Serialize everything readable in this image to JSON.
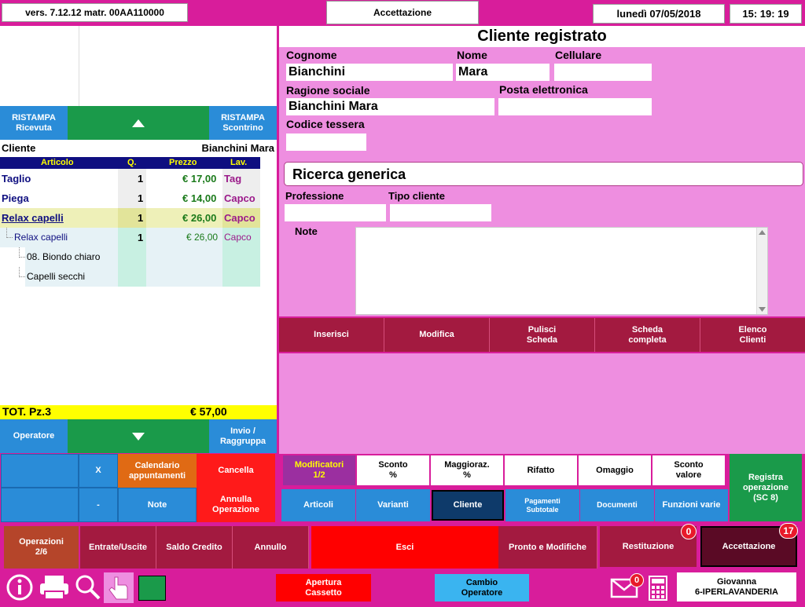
{
  "topbar": {
    "version": "vers. 7.12.12 matr. 00AA110000",
    "title": "Accettazione",
    "date": "lunedì 07/05/2018",
    "time": "15: 19: 19"
  },
  "left": {
    "reprint_receipt": "RISTAMPA\nRicevuta",
    "reprint_ticket": "RISTAMPA\nScontrino",
    "customer_label": "Cliente",
    "customer_name": "Bianchini Mara",
    "columns": [
      "Articolo",
      "Q.",
      "Prezzo",
      "Lav."
    ],
    "rows": [
      {
        "article": "Taglio",
        "qty": "1",
        "price": "€ 17,00",
        "lav": "Tag"
      },
      {
        "article": "Piega",
        "qty": "1",
        "price": "€ 14,00",
        "lav": "Capco"
      },
      {
        "article": "Relax capelli",
        "qty": "1",
        "price": "€ 26,00",
        "lav": "Capco"
      },
      {
        "article": "Relax capelli",
        "qty": "1",
        "price": "€ 26,00",
        "lav": "Capco"
      },
      {
        "article": "08. Biondo chiaro"
      },
      {
        "article": "Capelli secchi"
      }
    ],
    "total_label": "TOT. Pz.3",
    "total_value": "€ 57,00",
    "operator_button": "Operatore",
    "send_group": "Invio /\nRaggruppa",
    "grid": {
      "x": "X",
      "calendar": "Calendario\nappuntamenti",
      "cancel": "Cancella",
      "minus": "-",
      "notes": "Note",
      "cancel_op": "Annulla\nOperazione"
    }
  },
  "form": {
    "title": "Cliente registrato",
    "surname_label": "Cognome",
    "surname": "Bianchini",
    "name_label": "Nome",
    "name": "Mara",
    "mobile_label": "Cellulare",
    "mobile": "",
    "company_label": "Ragione sociale",
    "company": "Bianchini Mara",
    "email_label": "Posta elettronica",
    "email": "",
    "card_label": "Codice tessera",
    "card": "",
    "search_title": "Ricerca generica",
    "profession_label": "Professione",
    "client_type_label": "Tipo cliente",
    "notes_label": "Note",
    "actions": [
      "Inserisci",
      "Modifica",
      "Pulisci\nScheda",
      "Scheda\ncompleta",
      "Elenco\nClienti"
    ]
  },
  "modifiers": {
    "modifiers": "Modificatori\n1/2",
    "discount_pct": "Sconto\n%",
    "markup_pct": "Maggioraz.\n%",
    "redo": "Rifatto",
    "gift": "Omaggio",
    "discount_value": "Sconto\nvalore",
    "register": "Registra\noperazione\n(SC 8)"
  },
  "tabs": [
    "Articoli",
    "Varianti",
    "Cliente",
    "Pagamenti\nSubtotale",
    "Documenti",
    "Funzioni varie"
  ],
  "bottom_row": {
    "operations": "Operazioni\n2/6",
    "inout": "Entrate/Uscite",
    "credit": "Saldo Credito",
    "annul": "Annullo",
    "exit": "Esci",
    "ready": "Pronto e Modifiche",
    "returns": "Restituzione",
    "returns_badge": "0",
    "accept": "Accettazione",
    "accept_badge": "17"
  },
  "footer": {
    "open_drawer": "Apertura\nCassetto",
    "change_operator": "Cambio\nOperatore",
    "mail_badge": "0",
    "user": "Giovanna\n6-IPERLAVANDERIA"
  },
  "colors": {
    "magenta": "#d81d9b",
    "pink_panel": "#ee8ee0",
    "green": "#1a9a4a",
    "blue": "#2a8cd8",
    "crimson": "#a31a40",
    "red": "#ff1a1a",
    "orange": "#e06a14",
    "yellow": "#ffff00"
  }
}
